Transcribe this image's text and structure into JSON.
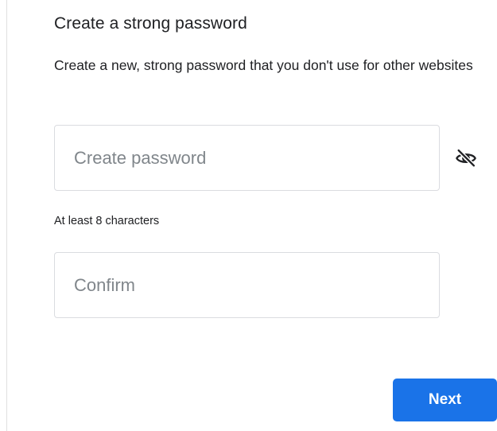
{
  "header": {
    "title": "Create a strong password",
    "subtitle": "Create a new, strong password that you don't use for other websites"
  },
  "form": {
    "password": {
      "placeholder": "Create password",
      "value": "",
      "hint": "At least 8 characters",
      "toggle_icon": "eye-off-icon"
    },
    "confirm": {
      "placeholder": "Confirm",
      "value": ""
    }
  },
  "actions": {
    "next_label": "Next"
  },
  "colors": {
    "primary": "#1a73e8",
    "text": "#202124",
    "placeholder": "#80868b",
    "border": "#dadce0"
  }
}
